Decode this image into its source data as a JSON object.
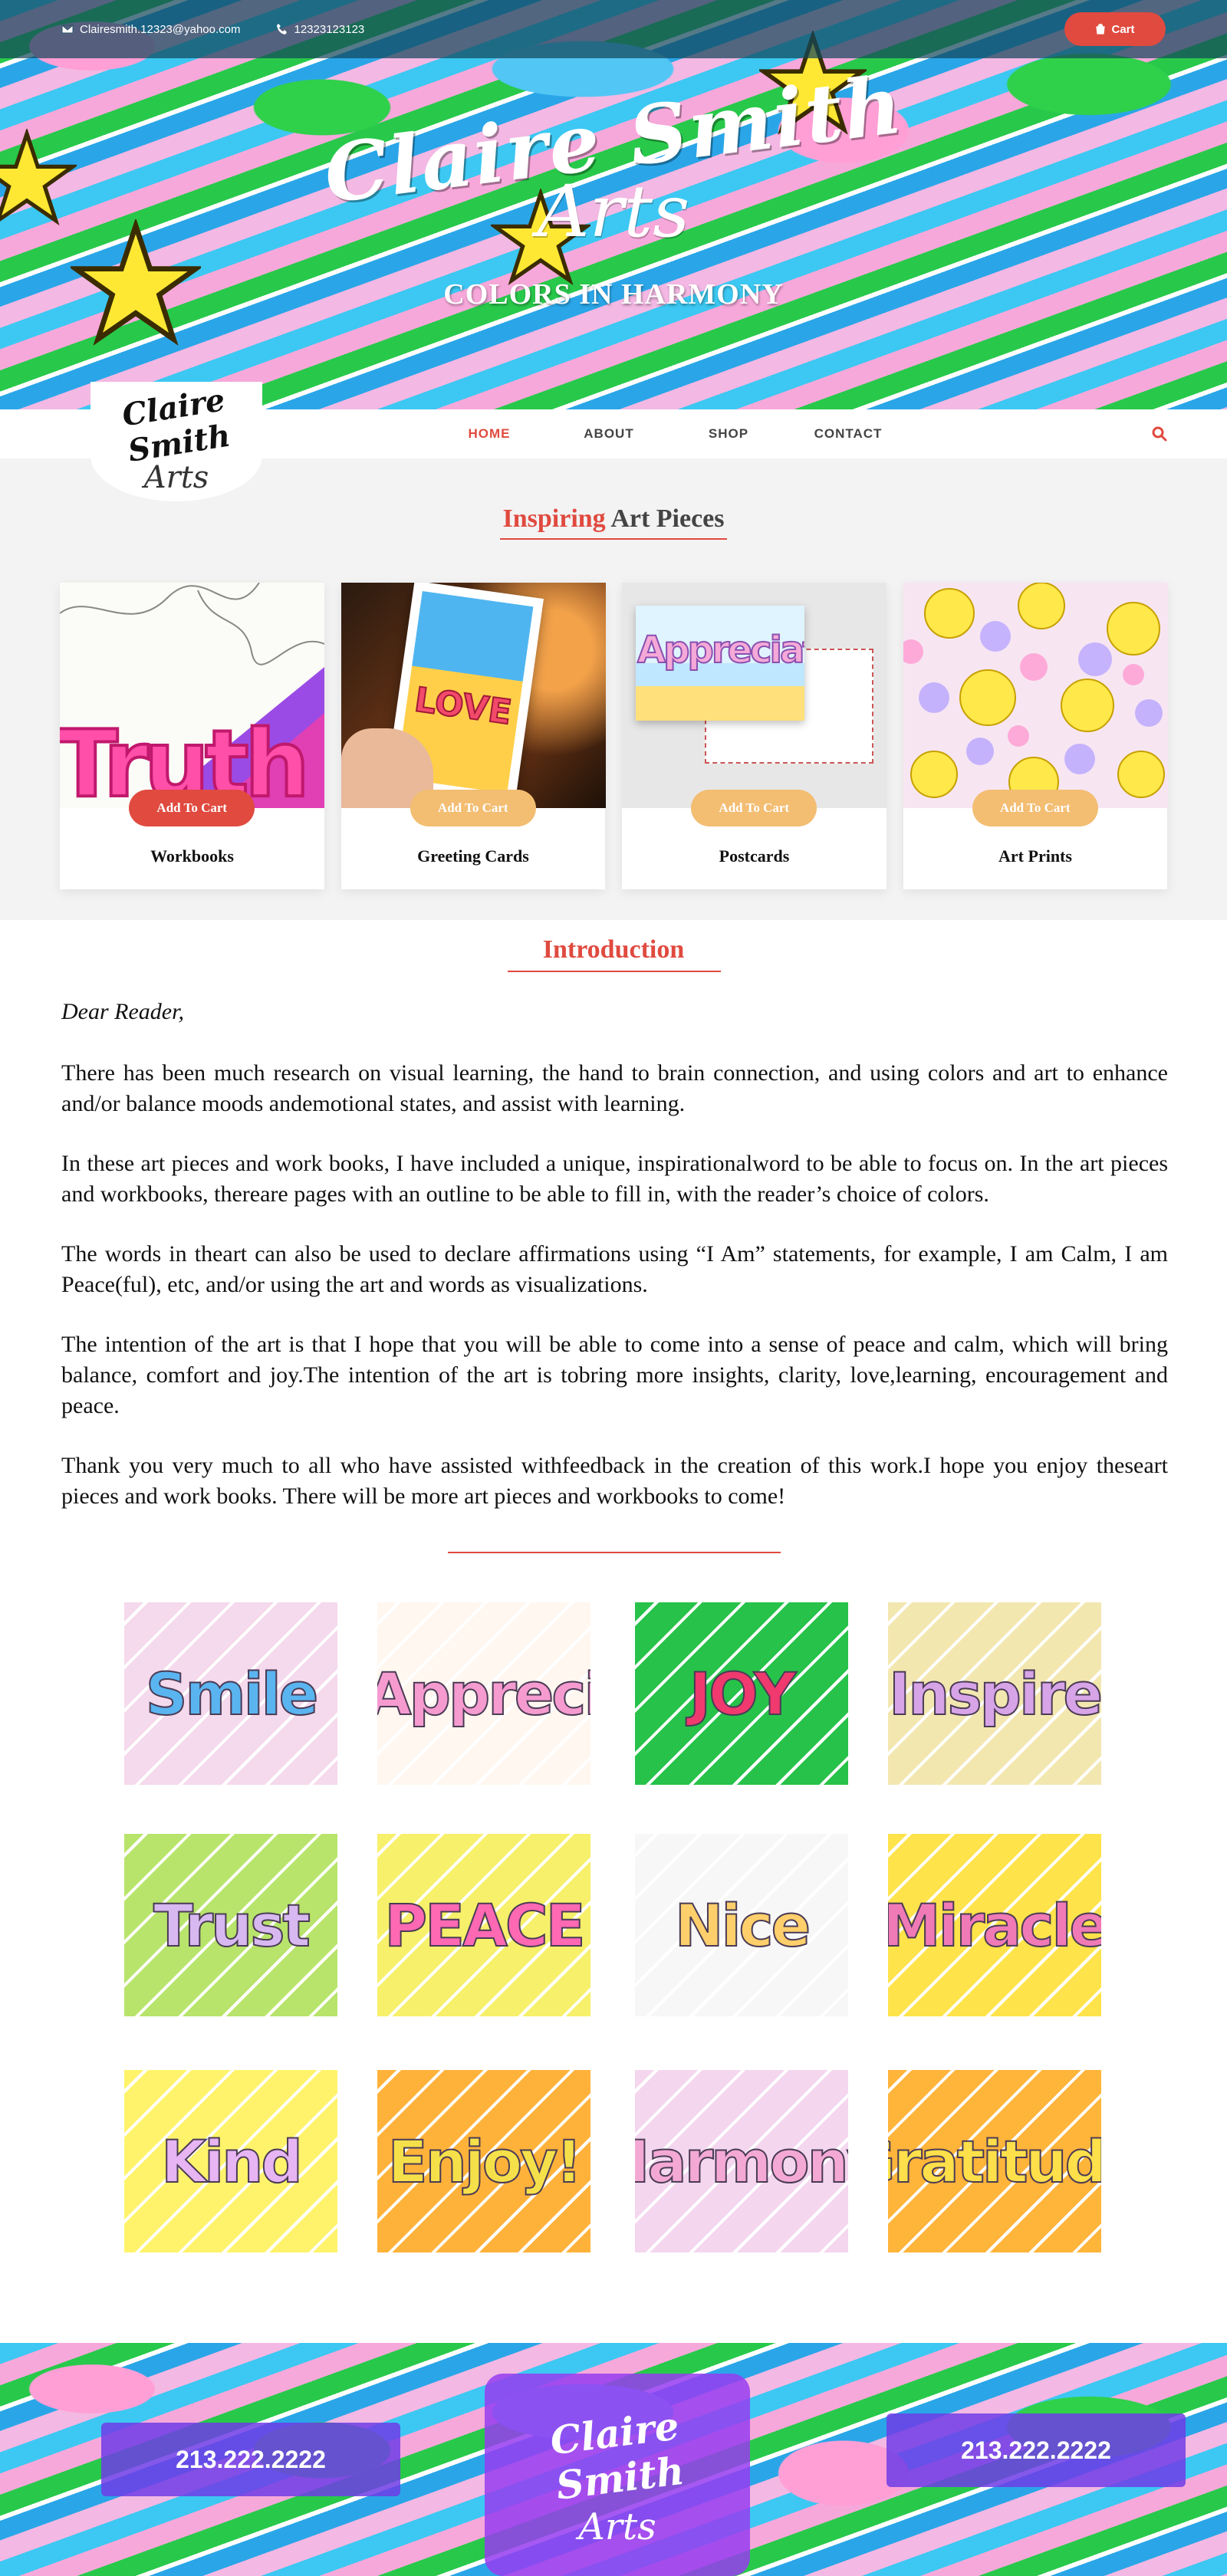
{
  "topbar": {
    "email": "Clairesmith.12323@yahoo.com",
    "phone": "12323123123",
    "cart_label": "Cart"
  },
  "hero": {
    "logo_script": "Claire Smith",
    "logo_arts": "Arts",
    "tagline": "COLORS IN HARMONY"
  },
  "nav": {
    "logo_script": "Claire Smith",
    "logo_arts": "Arts",
    "items": [
      {
        "label": "HOME",
        "active": true
      },
      {
        "label": "ABOUT",
        "active": false
      },
      {
        "label": "SHOP",
        "active": false
      },
      {
        "label": "CONTACT",
        "active": false
      }
    ],
    "search_icon": "search-icon"
  },
  "inspiring": {
    "title_accent": "Inspiring",
    "title_rest": "Art Pieces",
    "cards": [
      {
        "name": "Workbooks",
        "button": "Add To Cart",
        "button_color": "#e04a3f",
        "art_word": "Truth"
      },
      {
        "name": "Greeting Cards",
        "button": "Add To Cart",
        "button_color": "#f3bd72",
        "art_word": "LOVE"
      },
      {
        "name": "Postcards",
        "button": "Add To Cart",
        "button_color": "#f3bd72",
        "art_word": "Appreciat"
      },
      {
        "name": "Art Prints",
        "button": "Add To Cart",
        "button_color": "#f3bd72",
        "art_word": ""
      }
    ]
  },
  "introduction": {
    "title": "Introduction",
    "greeting": "Dear Reader,",
    "paragraphs": [
      "There has been much research on visual learning, the hand to brain connection, and using colors and art to enhance and/or balance moods andemotional states, and assist with learning.",
      "In these art pieces and work books, I have included a unique, inspirationalword to be able to focus on. In the art pieces and workbooks, thereare pages with an outline to be able to fill in, with the reader’s choice of colors.",
      "The words in theart can also be used to declare affirmations using “I Am” statements, for example, I am Calm, I am Peace(ful), etc, and/or using the art and words as visualizations.",
      "The intention of the art is that I hope that you will be able to come into a sense of peace and calm, which will bring balance, comfort and joy.The intention of the art is tobring more insights, clarity, love,learning, encouragement and peace.",
      "Thank you very much to all who have assisted withfeedback in the creation of this work.I hope you enjoy theseart pieces and work books. There will be more art pieces and workbooks to come!"
    ]
  },
  "gallery": {
    "tiles": [
      {
        "word": "Smile",
        "bg": "#f5d9ec",
        "fg": "#5ab4f0"
      },
      {
        "word": "Appreci",
        "bg": "#fff7f0",
        "fg": "#f59bd0"
      },
      {
        "word": "JOY",
        "bg": "#27c24a",
        "fg": "#f0396e"
      },
      {
        "word": "Inspire",
        "bg": "#f3e7b0",
        "fg": "#d7a4e8"
      },
      {
        "word": "Trust",
        "bg": "#b8e46b",
        "fg": "#d7b8f0"
      },
      {
        "word": "PEACE",
        "bg": "#f7f06a",
        "fg": "#ff69b4"
      },
      {
        "word": "Nice",
        "bg": "#f7f7f7",
        "fg": "#ffcf6b"
      },
      {
        "word": "Miracle",
        "bg": "#ffe34a",
        "fg": "#f07ab6"
      },
      {
        "word": "Kind",
        "bg": "#fff36b",
        "fg": "#e7b5f3"
      },
      {
        "word": "Enjoy!",
        "bg": "#ffb23a",
        "fg": "#f6e04a"
      },
      {
        "word": "Harmony",
        "bg": "#f4d6ef",
        "fg": "#f4a9d4"
      },
      {
        "word": "Gratitude",
        "bg": "#ffb43a",
        "fg": "#ffe04a"
      }
    ]
  },
  "footer": {
    "phone_left": "213.222.2222",
    "phone_right": "213.222.2222",
    "logo_script": "Claire Smith",
    "logo_arts": "Arts"
  }
}
